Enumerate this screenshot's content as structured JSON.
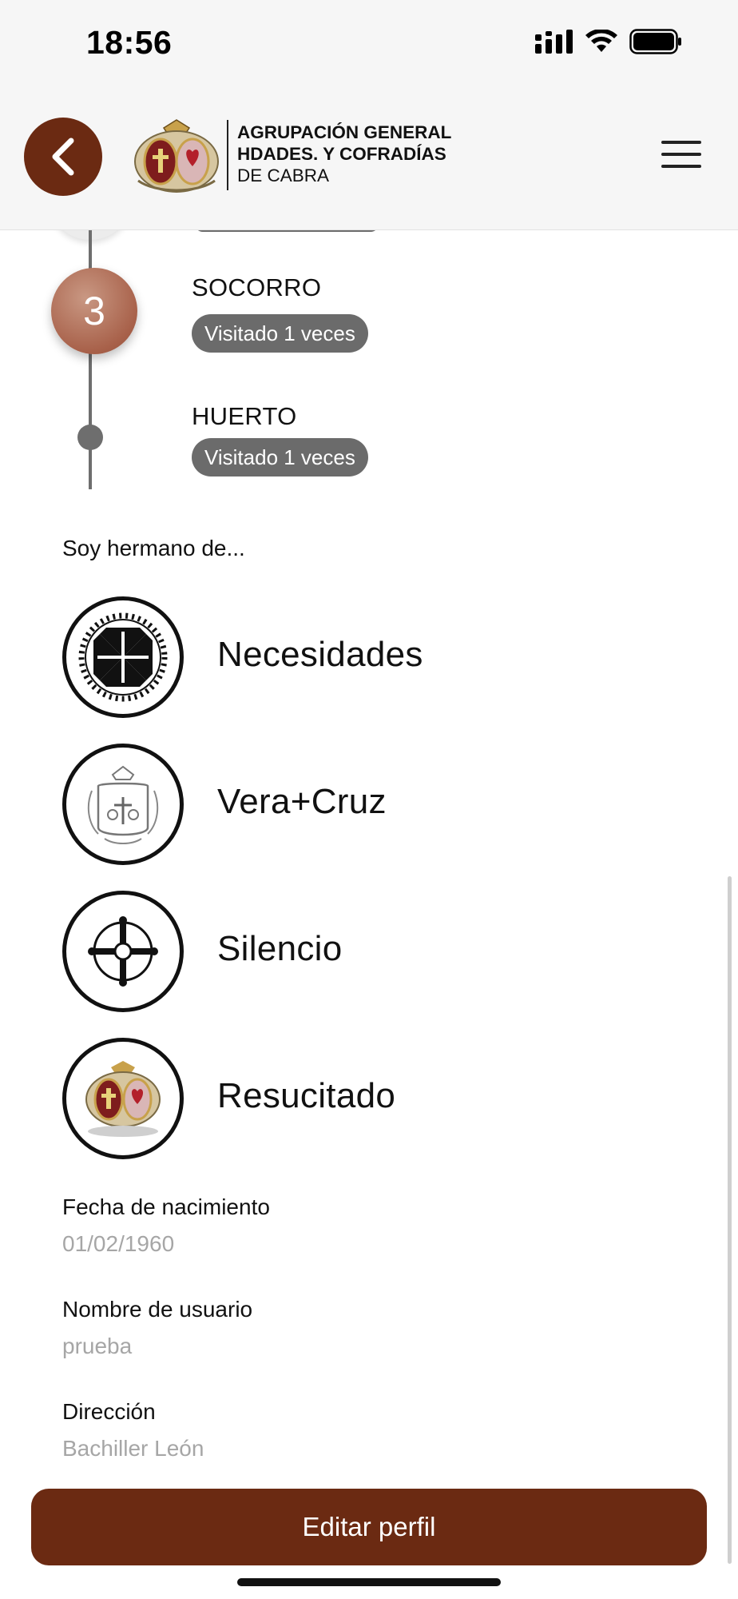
{
  "status_bar": {
    "time": "18:56"
  },
  "header": {
    "brand_line1": "AGRUPACIÓN GENERAL",
    "brand_line2": "HDADES. Y COFRADÍAS",
    "brand_line3": "DE CABRA"
  },
  "route": {
    "stops": [
      {
        "number": "3",
        "name": "SOCORRO",
        "visits": "Visitado 1 veces"
      },
      {
        "name": "HUERTO",
        "visits": "Visitado 1 veces"
      }
    ]
  },
  "brotherhoods": {
    "label": "Soy hermano de...",
    "items": [
      {
        "name": "Necesidades",
        "icon": "cross-of-thorns-emblem-icon"
      },
      {
        "name": "Vera+Cruz",
        "icon": "vera-cruz-crest-icon"
      },
      {
        "name": "Silencio",
        "icon": "silencio-cross-emblem-icon"
      },
      {
        "name": "Resucitado",
        "icon": "agrupacion-crest-icon"
      }
    ]
  },
  "profile": {
    "birthdate_label": "Fecha de nacimiento",
    "birthdate_value": "01/02/1960",
    "username_label": "Nombre de usuario",
    "username_value": "prueba",
    "address_label": "Dirección",
    "address_value": "Bachiller León"
  },
  "actions": {
    "edit_profile": "Editar perfil"
  },
  "colors": {
    "accent": "#6b2a12",
    "pill": "#6b6b6b",
    "step": "#a8614a",
    "muted_text": "#a6a6a6"
  }
}
